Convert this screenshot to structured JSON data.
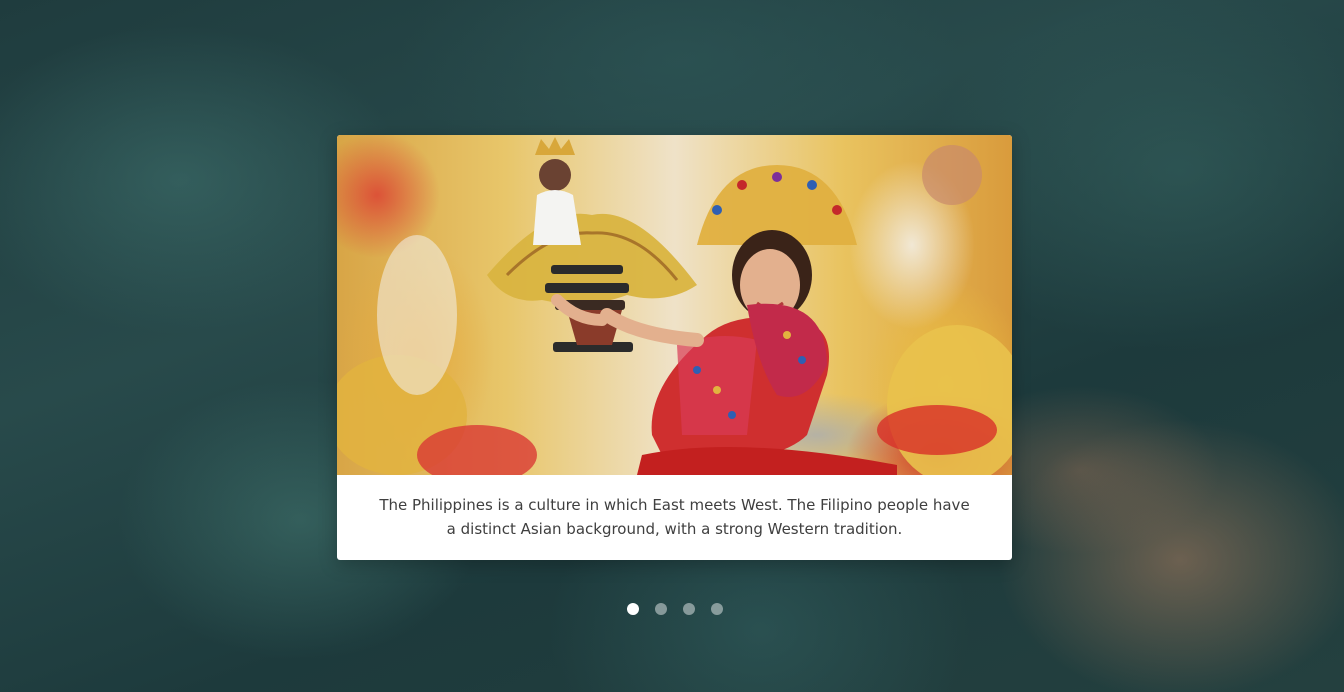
{
  "slide": {
    "image_alt": "Festival dancer in red and gold costume holding a Santo Niño figure",
    "caption": "The Philippines is a culture in which East meets West. The Filipino people have a distinct Asian background, with a strong Western tradition."
  },
  "pagination": {
    "total": 4,
    "active": 1
  }
}
